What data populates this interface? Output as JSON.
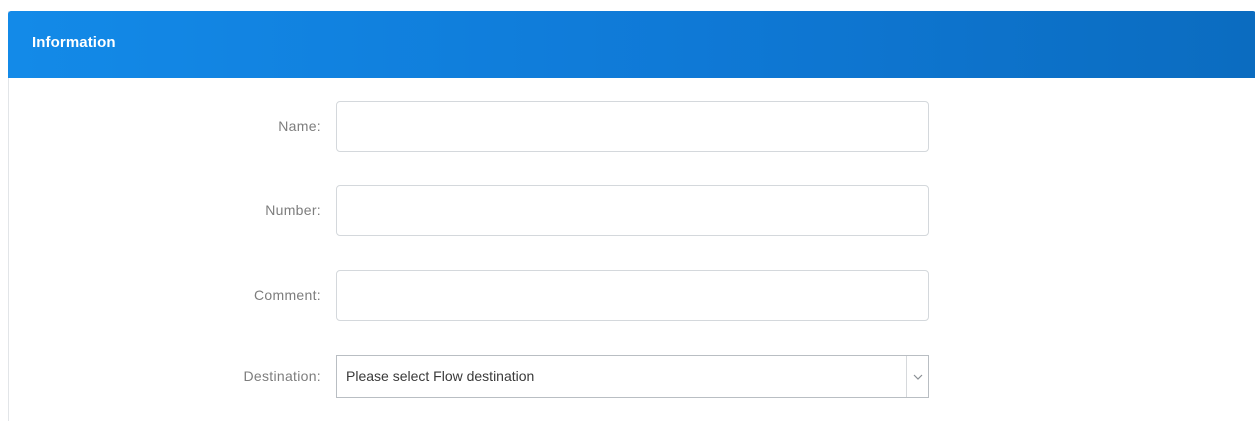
{
  "panel": {
    "title": "Information"
  },
  "form": {
    "name": {
      "label": "Name:",
      "value": "",
      "placeholder": ""
    },
    "number": {
      "label": "Number:",
      "value": "",
      "placeholder": ""
    },
    "comment": {
      "label": "Comment:",
      "value": "",
      "placeholder": ""
    },
    "destination": {
      "label": "Destination:",
      "selected": "Please select Flow destination",
      "icon": "chevron-down-icon"
    }
  },
  "colors": {
    "header_start": "#138ae8",
    "header_end": "#0b6cc0",
    "label": "#7d7d7d",
    "border": "#d4d8dc"
  }
}
